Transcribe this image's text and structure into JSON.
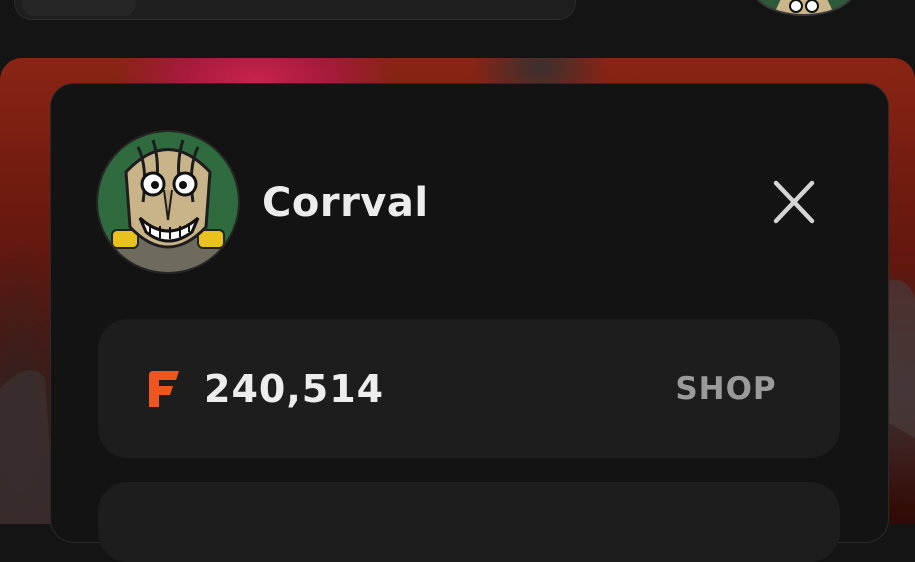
{
  "header": {
    "search_bar": {},
    "profile_avatar_icon": "profile-avatar-icon"
  },
  "profile_panel": {
    "avatar_icon": "user-avatar-icon",
    "username": "Corrval",
    "close_icon": "close-icon",
    "wallet": {
      "currency_icon": "coin-icon",
      "balance": "240,514",
      "shop_label": "SHOP"
    }
  },
  "colors": {
    "accent": "#f0551e",
    "panel": "#131313",
    "card": "#1d1d1d",
    "text_primary": "#ececec",
    "text_muted": "#9a9a9a"
  }
}
